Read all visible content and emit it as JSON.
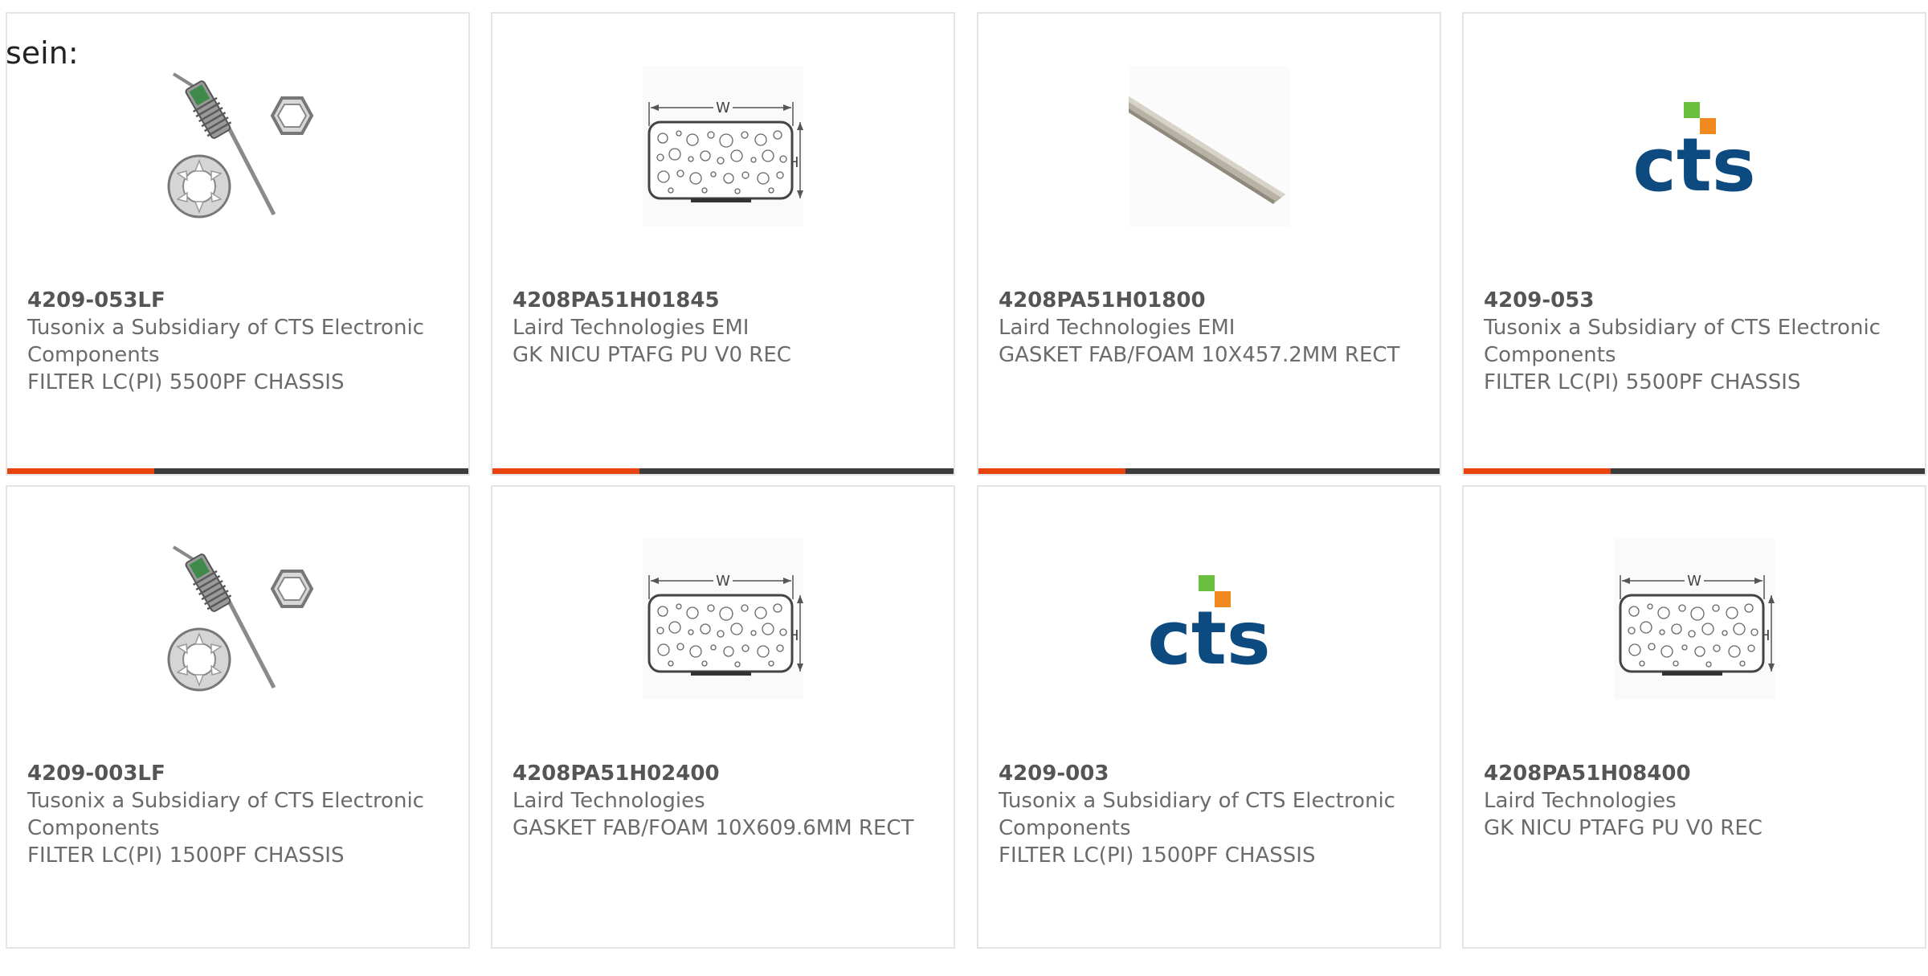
{
  "prefix_text": "sein:",
  "colors": {
    "accent": "#e8420f",
    "bar": "#3c3c3c",
    "cts_blue": "#0c4a80",
    "cts_green": "#6abf3e",
    "cts_orange": "#f08a1f"
  },
  "products": [
    {
      "part_number": "4209-053LF",
      "manufacturer": "Tusonix a Subsidiary of CTS Electronic Components",
      "description": "FILTER LC(PI) 5500PF CHASSIS",
      "image": "filter-feedthrough-image"
    },
    {
      "part_number": "4208PA51H01845",
      "manufacturer": "Laird Technologies EMI",
      "description": "GK NICU PTAFG PU V0 REC",
      "image": "gasket-diagram-image"
    },
    {
      "part_number": "4208PA51H01800",
      "manufacturer": "Laird Technologies EMI",
      "description": "GASKET FAB/FOAM 10X457.2MM RECT",
      "image": "gasket-strip-image"
    },
    {
      "part_number": "4209-053",
      "manufacturer": "Tusonix a Subsidiary of CTS Electronic Components",
      "description": "FILTER LC(PI) 5500PF CHASSIS",
      "image": "cts-logo-image"
    },
    {
      "part_number": "4209-003LF",
      "manufacturer": "Tusonix a Subsidiary of CTS Electronic Components",
      "description": "FILTER LC(PI) 1500PF CHASSIS",
      "image": "filter-feedthrough-image"
    },
    {
      "part_number": "4208PA51H02400",
      "manufacturer": "Laird Technologies",
      "description": "GASKET FAB/FOAM 10X609.6MM RECT",
      "image": "gasket-diagram-image"
    },
    {
      "part_number": "4209-003",
      "manufacturer": "Tusonix a Subsidiary of CTS Electronic Components",
      "description": "FILTER LC(PI) 1500PF CHASSIS",
      "image": "cts-logo-image"
    },
    {
      "part_number": "4208PA51H08400",
      "manufacturer": "Laird Technologies",
      "description": "GK NICU PTAFG PU V0 REC",
      "image": "gasket-diagram-image"
    }
  ],
  "labels": {
    "diagram_width": "W",
    "diagram_height": "H",
    "logo_text": "cts"
  }
}
